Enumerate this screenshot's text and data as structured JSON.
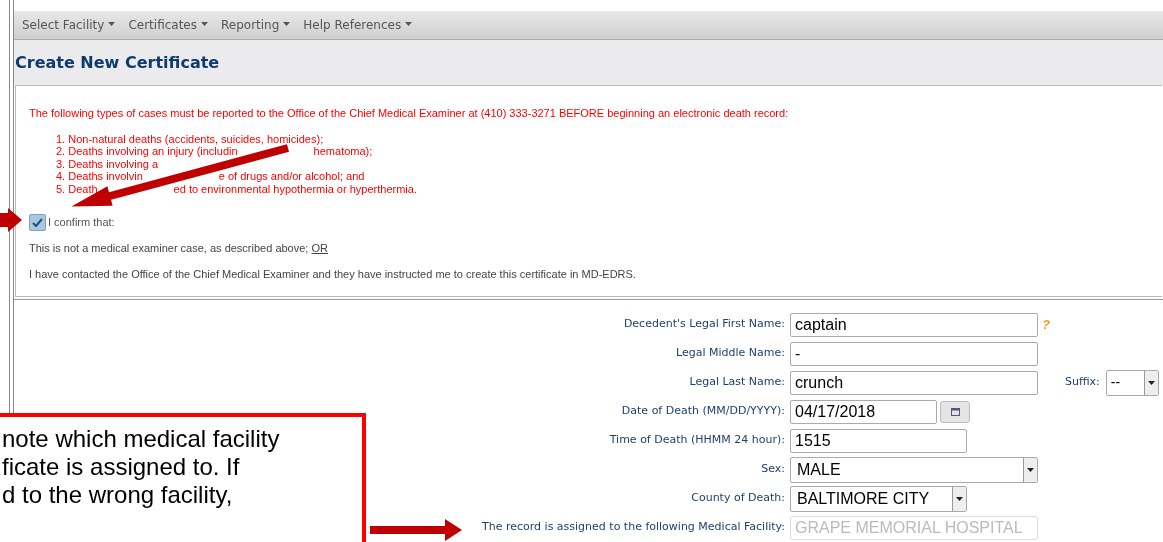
{
  "menu": [
    {
      "label": "Select Facility"
    },
    {
      "label": "Certificates"
    },
    {
      "label": "Reporting"
    },
    {
      "label": "Help References"
    }
  ],
  "page_title": "Create New Certificate",
  "notice": {
    "intro": "The following types of cases must be reported to the Office of the Chief Medical Examiner at (410) 333-3271 BEFORE beginning an electronic death record:",
    "items": [
      [
        "1. Non-natural deaths (accidents, suicides, homicides);"
      ],
      [
        "2. Deaths involving an injury (includin",
        "hematoma);"
      ],
      [
        "3. Deaths involving a"
      ],
      [
        "4. Deaths involvin",
        "e of drugs and/or alcohol; and"
      ],
      [
        "5. Death",
        "ed to environmental hypothermia or hyperthermia."
      ]
    ]
  },
  "confirm": {
    "label": "I confirm that:",
    "checked": true
  },
  "statements": [
    {
      "text": "This is not a medical examiner case, as described above; ",
      "link": "OR"
    },
    {
      "text": "I have contacted the Office of the Chief Medical Examiner and they have instructed me to create this certificate in MD-EDRS."
    }
  ],
  "fields": [
    {
      "label": "Decedent's Legal First Name:",
      "kind": "text",
      "value": "captain",
      "disabled": false,
      "help": "?"
    },
    {
      "label": "Legal Middle Name:",
      "kind": "text",
      "value": "-",
      "disabled": false
    },
    {
      "label": "Legal Last Name:",
      "kind": "text",
      "value": "crunch",
      "disabled": false,
      "suffix": {
        "label": "Suffix:",
        "value": "--"
      }
    },
    {
      "label": "Date of Death (MM/DD/YYYY):",
      "kind": "date",
      "value": "04/17/2018",
      "disabled": false
    },
    {
      "label": "Time of Death (HHMM 24 hour):",
      "kind": "short",
      "value": "1515",
      "disabled": false
    },
    {
      "label": "Sex:",
      "kind": "select",
      "value": "MALE",
      "disabled": false
    },
    {
      "label": "County of Death:",
      "kind": "short-select",
      "value": "BALTIMORE CITY",
      "disabled": false
    },
    {
      "label": "The record is assigned to the following Medical Facility:",
      "kind": "text",
      "value": "GRAPE MEMORIAL HOSPITAL",
      "disabled": true
    }
  ],
  "callout": {
    "lines": [
      "note which medical facility",
      "ficate is assigned to. If",
      "d to the wrong facility,"
    ]
  }
}
